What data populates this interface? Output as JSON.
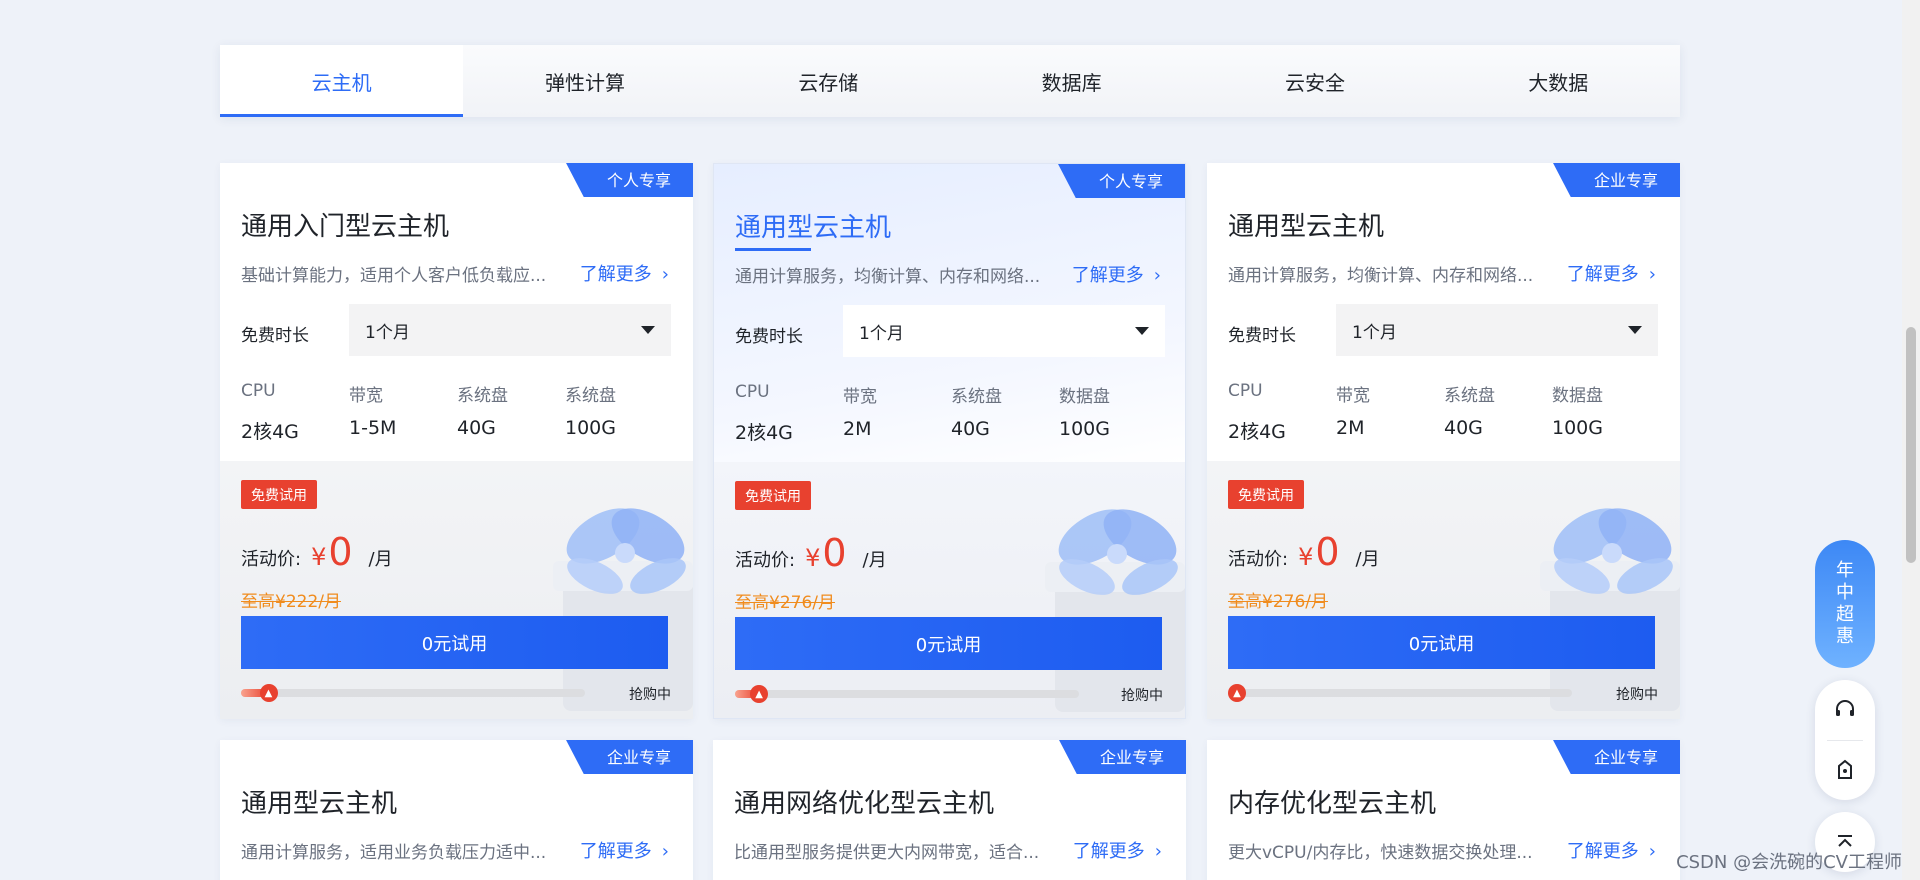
{
  "tabs": [
    {
      "label": "云主机",
      "active": true
    },
    {
      "label": "弹性计算",
      "active": false
    },
    {
      "label": "云存储",
      "active": false
    },
    {
      "label": "数据库",
      "active": false
    },
    {
      "label": "云安全",
      "active": false
    },
    {
      "label": "大数据",
      "active": false
    }
  ],
  "free_duration_label": "免费时长",
  "learn_more_label": "了解更多",
  "trial_tag": "免费试用",
  "price_label": "活动价:",
  "currency": "¥",
  "price_unit": "/月",
  "trial_button": "0元试用",
  "grab_label": "抢购中",
  "cards": [
    {
      "badge": "个人专享",
      "title": "通用入门型云主机",
      "desc": "基础计算能力，适用个人客户低负载应...",
      "duration": "1个月",
      "specs": [
        {
          "k": "CPU",
          "v": "2核4G"
        },
        {
          "k": "带宽",
          "v": "1-5M"
        },
        {
          "k": "系统盘",
          "v": "40G"
        },
        {
          "k": "系统盘",
          "v": "100G"
        }
      ],
      "price": "0",
      "orig": "至高¥222/月",
      "progress": 0.08
    },
    {
      "badge": "个人专享",
      "title": "通用型云主机",
      "desc": "通用计算服务，均衡计算、内存和网络...",
      "duration": "1个月",
      "specs": [
        {
          "k": "CPU",
          "v": "2核4G"
        },
        {
          "k": "带宽",
          "v": "2M"
        },
        {
          "k": "系统盘",
          "v": "40G"
        },
        {
          "k": "数据盘",
          "v": "100G"
        }
      ],
      "price": "0",
      "orig": "至高¥276/月",
      "progress": 0.07
    },
    {
      "badge": "企业专享",
      "title": "通用型云主机",
      "desc": "通用计算服务，均衡计算、内存和网络...",
      "duration": "1个月",
      "specs": [
        {
          "k": "CPU",
          "v": "2核4G"
        },
        {
          "k": "带宽",
          "v": "2M"
        },
        {
          "k": "系统盘",
          "v": "40G"
        },
        {
          "k": "数据盘",
          "v": "100G"
        }
      ],
      "price": "0",
      "orig": "至高¥276/月",
      "progress": 0.0
    },
    {
      "badge": "企业专享",
      "title": "通用型云主机",
      "desc": "通用计算服务，适用业务负载压力适中..."
    },
    {
      "badge": "企业专享",
      "title": "通用网络优化型云主机",
      "desc": "比通用型服务提供更大内网带宽，适合..."
    },
    {
      "badge": "企业专享",
      "title": "内存优化型云主机",
      "desc": "更大vCPU/内存比，快速数据交换处理..."
    }
  ],
  "float_promo": [
    "年",
    "中",
    "超",
    "惠"
  ],
  "watermark": "CSDN @会洗碗的CV工程师"
}
